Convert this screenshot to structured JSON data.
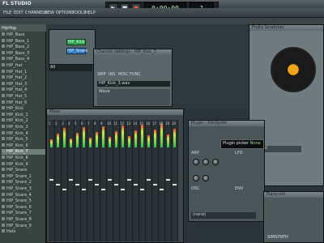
{
  "app": {
    "title": "FL STUDIO"
  },
  "menu": [
    "FILE",
    "EDIT",
    "CHANNELS",
    "VIEW",
    "OPTIONS",
    "TOOLS",
    "HELP"
  ],
  "transport": {
    "time": "0:00:00",
    "pattern": "1"
  },
  "browser": {
    "header": "Browser",
    "folder": "HipHop",
    "items": [
      "HIP_Bass",
      "HIP_Bass_1",
      "HIP_Bass_2",
      "HIP_Bass_3",
      "HIP_Bass_4",
      "HIP_Hat",
      "HIP_Hat_1",
      "HIP_Hat_2",
      "HIP_Hat_3",
      "HIP_Hat_4",
      "HIP_Hat_5",
      "HIP_Hat_6",
      "HIP_Kick",
      "HIP_Kick_1",
      "HIP_Kick_2",
      "HIP_Kick_3",
      "HIP_Kick_4",
      "HIP_Kick_5",
      "HIP_Kick_6",
      "HIP_Kick_7",
      "HIP_Kick_8",
      "HIP_Kick_9",
      "HIP_Snare",
      "HIP_Snare_1",
      "HIP_Snare_2",
      "HIP_Snare_3",
      "HIP_Snare_4",
      "HIP_Snare_5",
      "HIP_Snare_6",
      "HIP_Snare_7",
      "HIP_Snare_8",
      "HIP_Snare_9",
      "Hats"
    ],
    "selected_index": 19
  },
  "channel_window": {
    "title": "Channel settings - HIP_Kick_3",
    "tabs": [
      "SMP",
      "INS",
      "MISC",
      "FUNC"
    ],
    "sample": "HIP_Kick_3.wav",
    "wave_label": "Wave"
  },
  "pattern": {
    "buttons": [
      "HIP_Kick",
      "HIP_Snare"
    ],
    "preset": "All"
  },
  "mixer": {
    "title": "Mixer",
    "master_label": "M",
    "insert_labels": [
      "1",
      "2",
      "3",
      "4",
      "5",
      "6",
      "7",
      "8",
      "9",
      "10",
      "11",
      "12",
      "13",
      "14",
      "15",
      "16",
      "17",
      "18",
      "19",
      "20"
    ]
  },
  "scratcher": {
    "title": "Fruity Scratcher",
    "preset": "(none)"
  },
  "synth": {
    "title": "Plugin - SimSynth",
    "hint": "Plugin picker",
    "hint_value": "None",
    "label_arp": "ARP",
    "label_lfo": "LFO",
    "label_osc": "OSC",
    "label_env": "ENV",
    "footer": "(none)"
  },
  "piano": {
    "title": "Piano roll",
    "footer": "SIMSYNTH"
  }
}
